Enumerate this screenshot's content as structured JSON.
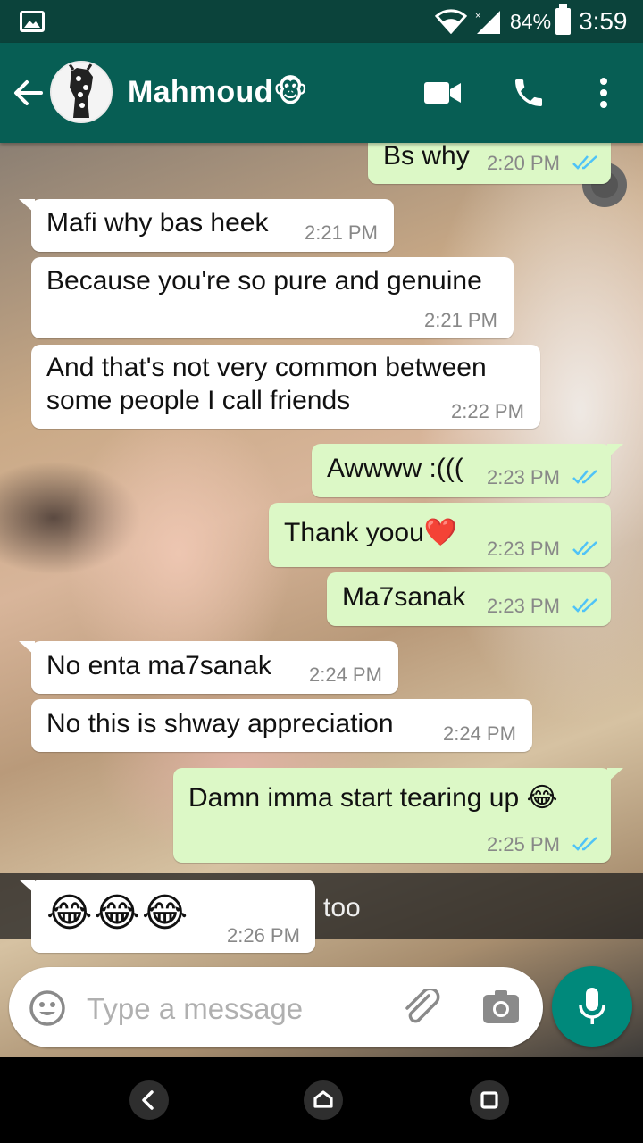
{
  "status_bar": {
    "battery_pct": "84%",
    "time": "3:59"
  },
  "header": {
    "contact_name": "Mahmoud🐵"
  },
  "messages": [
    {
      "dir": "out",
      "text": "Bs why",
      "time": "2:20 PM",
      "read": true
    },
    {
      "dir": "in",
      "text": "Mafi why bas heek",
      "time": "2:21 PM"
    },
    {
      "dir": "in",
      "text": "Because you're so pure and genuine",
      "time": "2:21 PM"
    },
    {
      "dir": "in",
      "text_lines": [
        "And that's not very common between",
        "some people I call friends"
      ],
      "time": "2:22 PM"
    },
    {
      "dir": "out",
      "text": "Awwww :(((",
      "time": "2:23 PM",
      "read": true
    },
    {
      "dir": "out",
      "text": "Thank yoou❤️",
      "time": "2:23 PM",
      "read": true
    },
    {
      "dir": "out",
      "text": "Ma7sanak",
      "time": "2:23 PM",
      "read": true
    },
    {
      "dir": "in",
      "text": "No enta ma7sanak",
      "time": "2:24 PM"
    },
    {
      "dir": "in",
      "text": "No this is shway appreciation",
      "time": "2:24 PM"
    },
    {
      "dir": "out",
      "text": "Damn imma start tearing up 😂",
      "time": "2:25 PM",
      "read": true
    },
    {
      "dir": "in",
      "text": "😂😂😂",
      "time": "2:26 PM"
    }
  ],
  "wallpaper_caption": "too",
  "composer": {
    "placeholder": "Type a message"
  },
  "icons": [
    "gallery-icon",
    "wifi-icon",
    "signal-icon",
    "battery-icon",
    "back-arrow-icon",
    "video-call-icon",
    "phone-icon",
    "more-vert-icon",
    "double-check-icon",
    "emoji-icon",
    "attach-icon",
    "camera-icon",
    "mic-icon",
    "nav-back-icon",
    "nav-home-icon",
    "nav-recents-icon"
  ],
  "colors": {
    "header": "#075e54",
    "status_bar": "#0b433b",
    "outgoing_bubble": "#dcf8c6",
    "incoming_bubble": "#ffffff",
    "read_ticks": "#4fc3f7",
    "mic_button": "#00897b"
  }
}
